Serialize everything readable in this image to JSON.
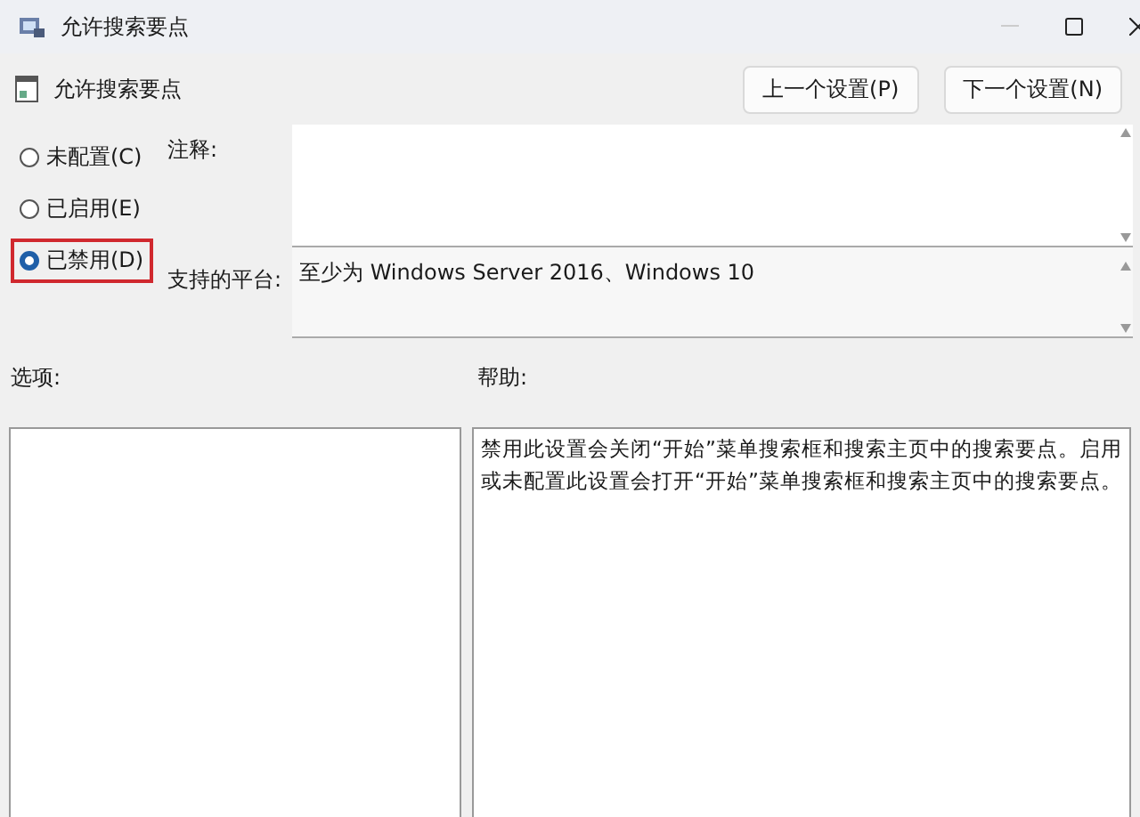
{
  "window": {
    "title": "允许搜索要点"
  },
  "header": {
    "title": "允许搜索要点"
  },
  "nav_buttons": [
    {
      "label": "上一个设置(P)"
    },
    {
      "label": "下一个设置(N)"
    }
  ],
  "options": [
    {
      "label": "未配置(C)",
      "selected": false
    },
    {
      "label": "已启用(E)",
      "selected": false
    },
    {
      "label": "已禁用(D)",
      "selected": true
    }
  ],
  "comment": {
    "label": "注释:"
  },
  "platform": {
    "label": "支持的平台:",
    "value": "至少为 Windows Server 2016、Windows 10"
  },
  "options_panel": {
    "label": "选项:"
  },
  "help_panel": {
    "label": "帮助:",
    "text": "禁用此设置会关闭“开始”菜单搜索框和搜索主页中的搜索要点。启用或未配置此设置会打开“开始”菜单搜索框和搜索主页中的搜索要点。"
  }
}
